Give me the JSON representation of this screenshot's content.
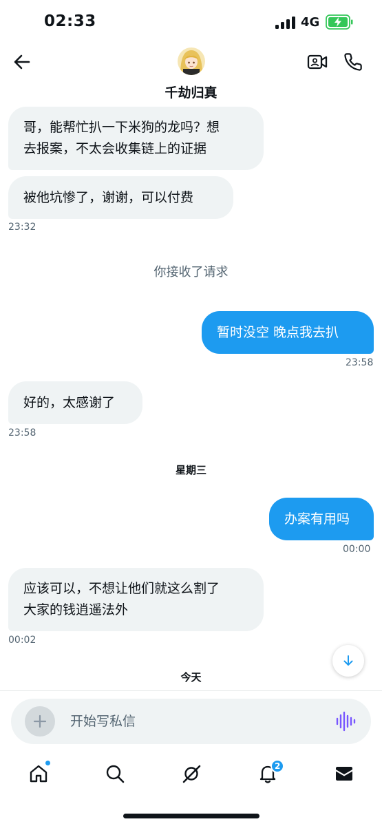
{
  "status_bar": {
    "time": "02:33",
    "network": "4G"
  },
  "header": {
    "contact_name": "千劫归真"
  },
  "messages": [
    {
      "text_lines": [
        "哥，能帮忙扒一下米狗的龙吗？想",
        "去报案，不太会收集链上的证据"
      ]
    },
    {
      "text": "被他坑惨了，谢谢，可以付费",
      "time": "23:32"
    },
    {
      "system": "你接收了请求"
    },
    {
      "text": "暂时没空 晚点我去扒",
      "time": "23:58"
    },
    {
      "text": "好的，太感谢了",
      "time": "23:58"
    },
    {
      "day": "星期三"
    },
    {
      "text": "办案有用吗",
      "time": "00:00"
    },
    {
      "text_lines": [
        "应该可以，不想让他们就这么割了",
        "大家的钱逍遥法外"
      ],
      "time": "00:02"
    },
    {
      "day": "今天"
    }
  ],
  "composer": {
    "placeholder": "开始写私信"
  },
  "tab_bar": {
    "notifications_badge": "2"
  },
  "colors": {
    "accent": "#1d9bf0",
    "incoming_bubble": "#eff3f4",
    "battery": "#34c759",
    "voice_icon": "#7856ff"
  }
}
